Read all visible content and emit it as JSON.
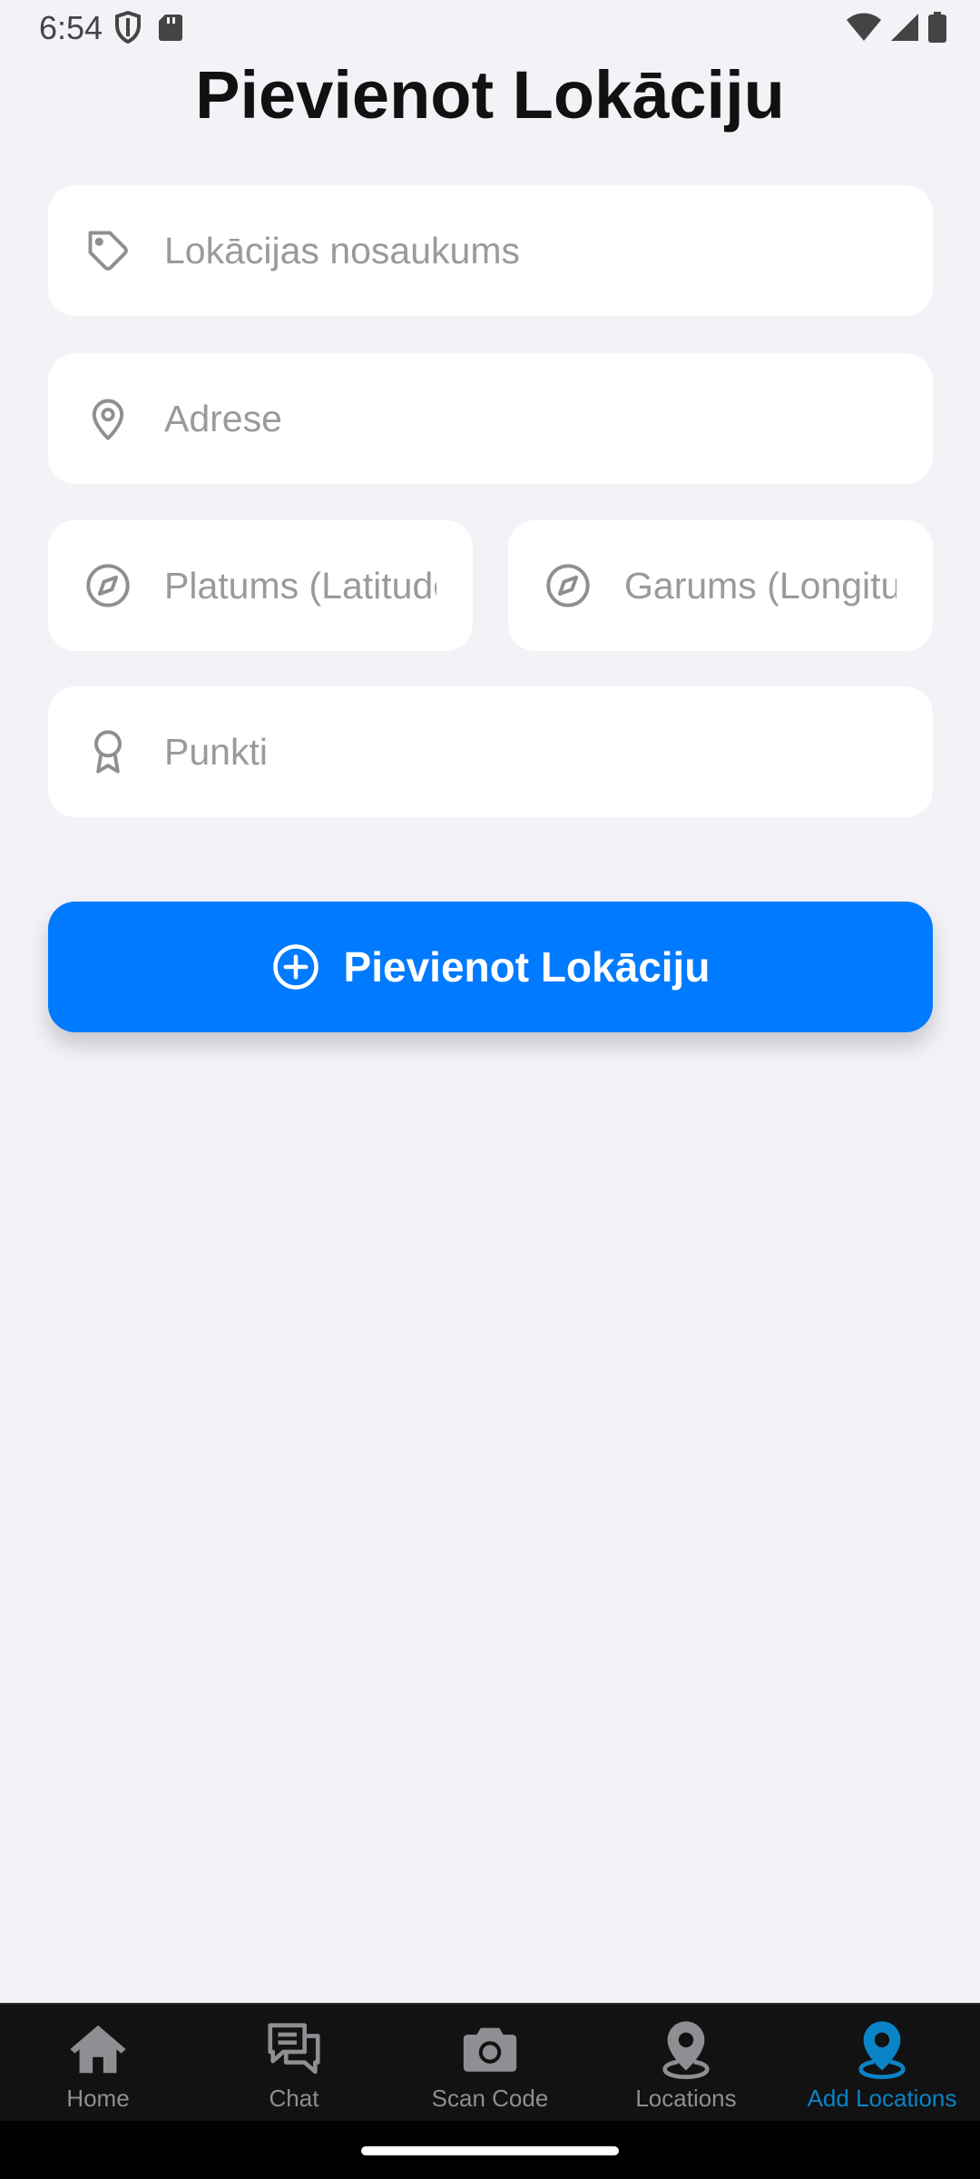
{
  "status_bar": {
    "time": "6:54",
    "icons": [
      "shield-icon",
      "sd-card-icon",
      "wifi-icon",
      "signal-icon",
      "battery-icon"
    ]
  },
  "page": {
    "title": "Pievienot Lokāciju"
  },
  "form": {
    "name": {
      "placeholder": "Lokācijas nosaukums",
      "value": "",
      "icon": "tag-icon"
    },
    "address": {
      "placeholder": "Adrese",
      "value": "",
      "icon": "location-pin-icon"
    },
    "latitude": {
      "placeholder": "Platums (Latitude)",
      "value": "",
      "icon": "compass-icon"
    },
    "longitude": {
      "placeholder": "Garums (Longitude)",
      "value": "",
      "icon": "compass-icon"
    },
    "points": {
      "placeholder": "Punkti",
      "value": "",
      "icon": "award-icon"
    },
    "submit_label": "Pievienot Lokāciju",
    "submit_icon": "plus-circle-icon"
  },
  "tab_bar": {
    "active_tab": "Add Locations",
    "active_color": "#0a84c6",
    "inactive_color": "#8e8e93",
    "tabs": [
      {
        "label": "Home",
        "icon": "home-icon"
      },
      {
        "label": "Chat",
        "icon": "chat-icon"
      },
      {
        "label": "Scan Code",
        "icon": "camera-icon"
      },
      {
        "label": "Locations",
        "icon": "map-pin-icon"
      },
      {
        "label": "Add Locations",
        "icon": "map-pin-icon"
      }
    ]
  },
  "colors": {
    "background": "#f2f2f7",
    "accent": "#007aff",
    "field_background": "#ffffff"
  }
}
